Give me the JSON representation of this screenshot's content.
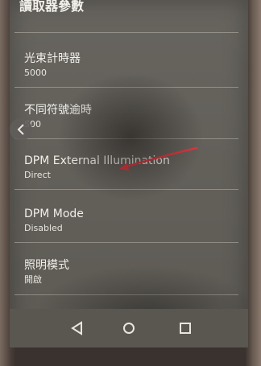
{
  "header": {
    "title": "讀取器參數"
  },
  "items": [
    {
      "label": "光束計時器",
      "value": "5000"
    },
    {
      "label": "不同符號逾時",
      "value": "500"
    },
    {
      "label": "DPM External Illumination",
      "value": "Direct"
    },
    {
      "label": "DPM Mode",
      "value": "Disabled"
    },
    {
      "label": "照明模式",
      "value": "開啟"
    }
  ],
  "colors": {
    "screen": "#5e5b55",
    "text": "#f0eee8",
    "annotation_arrow": "#e0303a"
  }
}
